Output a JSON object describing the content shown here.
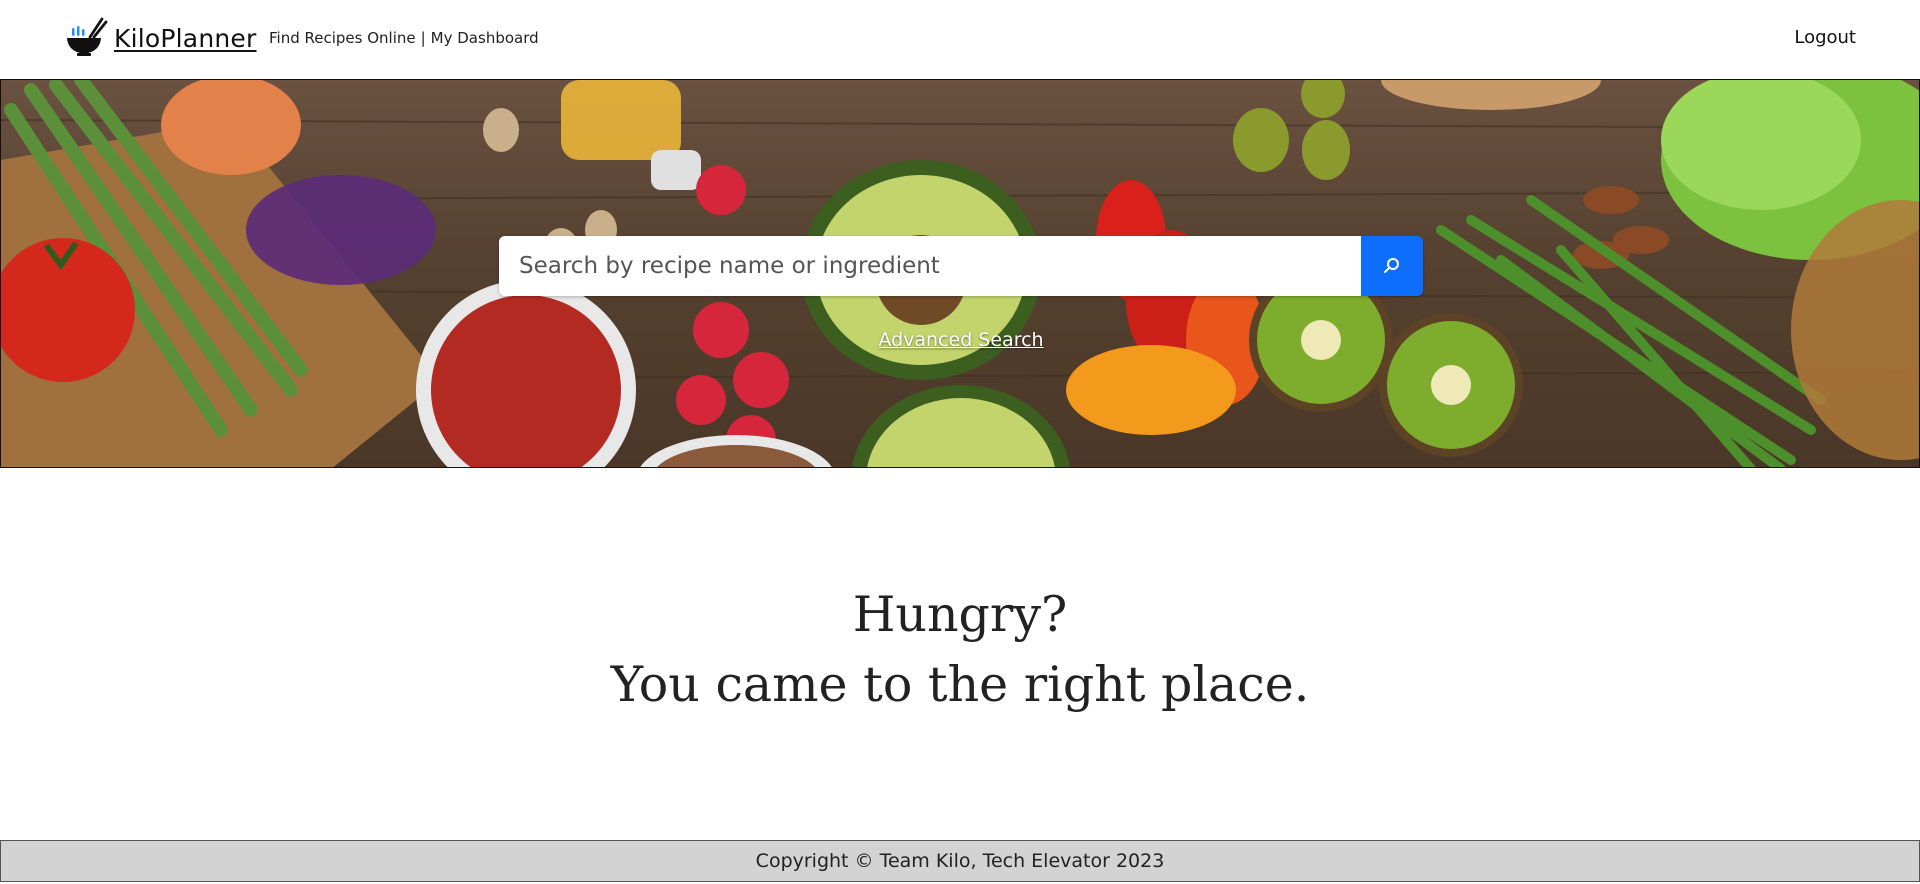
{
  "header": {
    "brand_name": "KiloPlanner",
    "nav_find_recipes": "Find Recipes Online",
    "nav_separator": "|",
    "nav_dashboard": "My Dashboard",
    "logout_label": "Logout",
    "logo_icon": "ramen-bowl-icon"
  },
  "hero": {
    "search_placeholder": "Search by recipe name or ingredient",
    "search_value": "",
    "search_button_icon": "search-icon",
    "advanced_search_label": "Advanced Search",
    "search_button_color": "#0d6efd"
  },
  "tagline": {
    "line1": "Hungry?",
    "line2": "You came to the right place."
  },
  "footer": {
    "copyright": "Copyright © Team Kilo, Tech Elevator 2023"
  }
}
